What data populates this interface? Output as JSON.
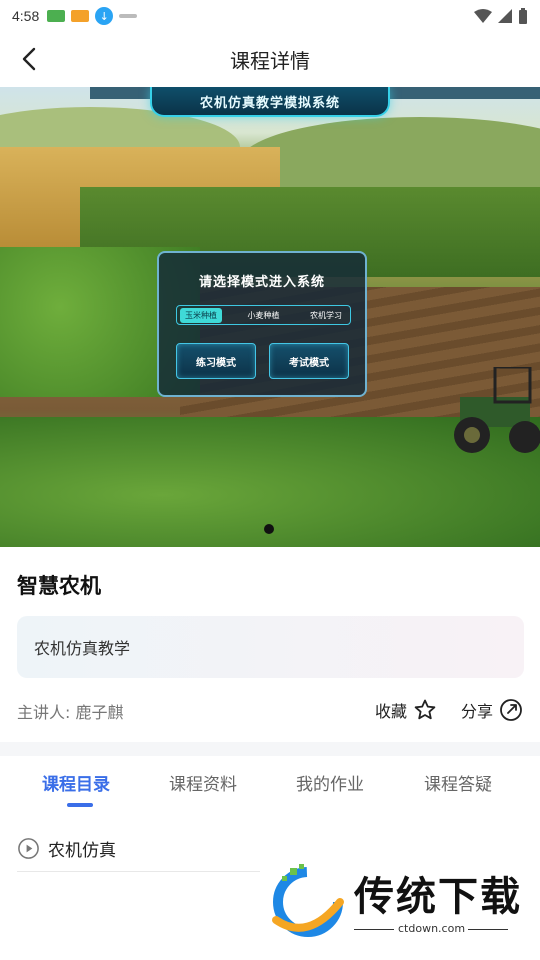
{
  "status_bar": {
    "time": "4:58"
  },
  "header": {
    "title": "课程详情"
  },
  "banner": {
    "system_title": "农机仿真教学模拟系统",
    "panel_title": "请选择模式进入系统",
    "mode_tabs": [
      "玉米种植",
      "小麦种植",
      "农机学习"
    ],
    "active_tab": 0,
    "practice_button": "练习模式",
    "exam_button": "考试模式",
    "slide_count": 1,
    "current_slide": 0
  },
  "course": {
    "title": "智慧农机",
    "description": "农机仿真教学",
    "lecturer": "主讲人: 鹿子麒",
    "favorite_label": "收藏",
    "share_label": "分享"
  },
  "tabs": [
    "课程目录",
    "课程资料",
    "我的作业",
    "课程答疑"
  ],
  "active_tab_index": 0,
  "catalog": [
    {
      "label": "农机仿真",
      "icon": "play-circle-icon"
    }
  ],
  "watermark": {
    "text": "传统下载",
    "url": "ctdown.com"
  },
  "colors": {
    "accent": "#3a6ee8",
    "panel_border": "#44c6e6"
  }
}
